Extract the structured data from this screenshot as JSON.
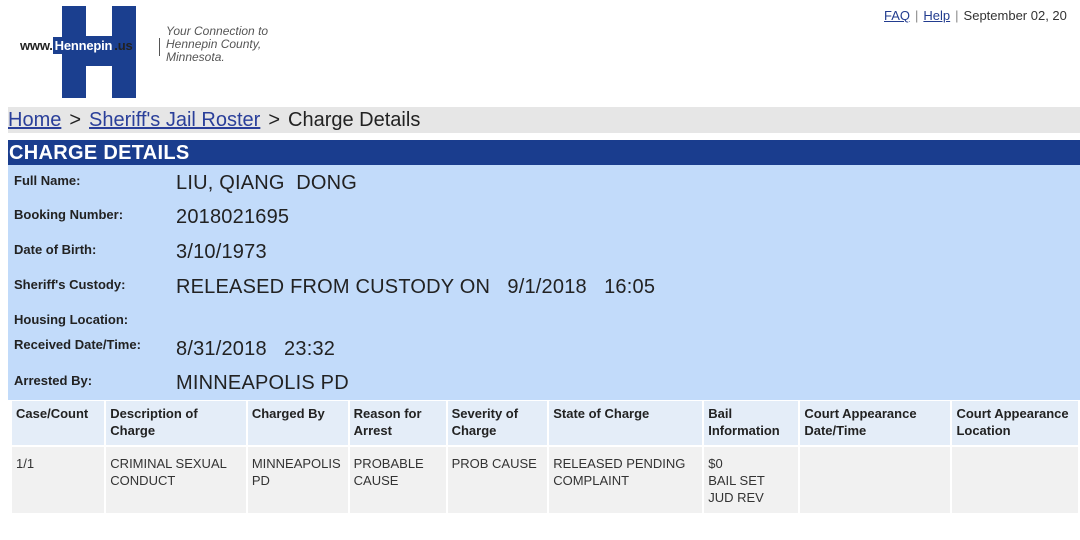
{
  "header": {
    "logo": {
      "www_prefix": "www.",
      "brand": "Hennepin",
      "suffix": ".us",
      "tagline": [
        "Your Connection to",
        "Hennepin County,",
        "Minnesota."
      ]
    },
    "links": {
      "faq": "FAQ",
      "help": "Help",
      "separator": "|",
      "date": "September 02, 20"
    }
  },
  "breadcrumb": {
    "home": "Home",
    "roster": "Sheriff's Jail Roster",
    "current": "Charge Details",
    "separator": ">"
  },
  "section_title": "CHARGE DETAILS",
  "details": [
    {
      "label": "Full Name:",
      "value": "LIU, QIANG  DONG"
    },
    {
      "label": "Booking Number:",
      "value": "2018021695"
    },
    {
      "label": "Date of Birth:",
      "value": "3/10/1973"
    },
    {
      "label": "Sheriff's Custody:",
      "value": "RELEASED FROM CUSTODY ON   9/1/2018   16:05"
    },
    {
      "label": "Housing Location:",
      "value": ""
    },
    {
      "label": "Received Date/Time:",
      "value": "8/31/2018   23:32"
    },
    {
      "label": "Arrested By:",
      "value": "MINNEAPOLIS PD"
    }
  ],
  "table": {
    "headers": [
      [
        "Case/Count"
      ],
      [
        "Description of",
        "Charge"
      ],
      [
        "Charged By"
      ],
      [
        "Reason for",
        "Arrest"
      ],
      [
        "Severity of",
        "Charge"
      ],
      [
        "State of Charge"
      ],
      [
        "Bail",
        "Information"
      ],
      [
        "Court Appearance",
        "Date/Time"
      ],
      [
        "Court Appearance",
        "Location"
      ]
    ],
    "rows": [
      [
        [
          "1/1"
        ],
        [
          "CRIMINAL SEXUAL",
          "CONDUCT"
        ],
        [
          "MINNEAPOLIS",
          "PD"
        ],
        [
          "PROBABLE",
          "CAUSE"
        ],
        [
          "PROB CAUSE"
        ],
        [
          "RELEASED PENDING",
          "COMPLAINT"
        ],
        [
          "$0",
          "BAIL SET",
          "JUD REV"
        ],
        [
          ""
        ],
        [
          ""
        ]
      ]
    ]
  }
}
